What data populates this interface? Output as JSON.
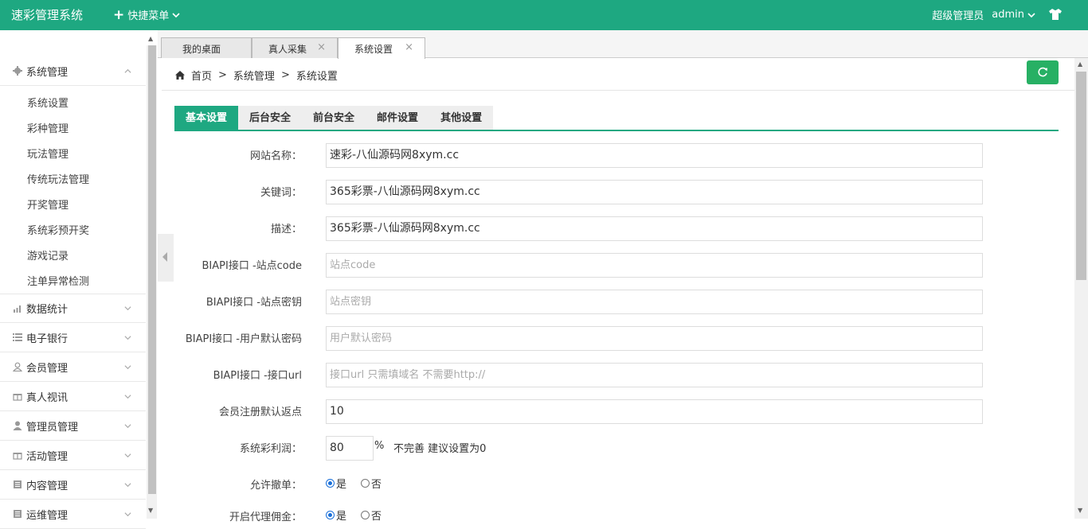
{
  "app": {
    "brand": "速彩管理系统",
    "quick_menu": "快捷菜单",
    "role": "超级管理员",
    "username": "admin",
    "accent": "#1ea881"
  },
  "sidebar": {
    "groups": [
      {
        "label": "系统管理",
        "icon": "gear-icon",
        "expanded": true,
        "items": [
          "系统设置",
          "彩种管理",
          "玩法管理",
          "传统玩法管理",
          "开奖管理",
          "系统彩预开奖",
          "游戏记录",
          "注单异常检测"
        ]
      },
      {
        "label": "数据统计",
        "icon": "chart-icon"
      },
      {
        "label": "电子银行",
        "icon": "list-icon"
      },
      {
        "label": "会员管理",
        "icon": "user-icon"
      },
      {
        "label": "真人视讯",
        "icon": "gift-icon"
      },
      {
        "label": "管理员管理",
        "icon": "person-icon"
      },
      {
        "label": "活动管理",
        "icon": "gift-icon"
      },
      {
        "label": "内容管理",
        "icon": "book-icon"
      },
      {
        "label": "运维管理",
        "icon": "book-icon"
      }
    ]
  },
  "tabs": [
    {
      "label": "我的桌面",
      "closable": false
    },
    {
      "label": "真人采集",
      "closable": true
    },
    {
      "label": "系统设置",
      "closable": true,
      "active": true
    }
  ],
  "breadcrumb": [
    "首页",
    "系统管理",
    "系统设置"
  ],
  "subtabs": [
    "基本设置",
    "后台安全",
    "前台安全",
    "邮件设置",
    "其他设置"
  ],
  "form": {
    "site_name": {
      "label": "网站名称：",
      "value": "速彩-八仙源码网8xym.cc"
    },
    "keywords": {
      "label": "关键词：",
      "value": "365彩票-八仙源码网8xym.cc"
    },
    "description": {
      "label": "描述：",
      "value": "365彩票-八仙源码网8xym.cc"
    },
    "biapi_code": {
      "label": "BIAPI接口 -站点code",
      "placeholder": "站点code"
    },
    "biapi_key": {
      "label": "BIAPI接口 -站点密钥",
      "placeholder": "站点密钥"
    },
    "biapi_pwd": {
      "label": "BIAPI接口 -用户默认密码",
      "placeholder": "用户默认密码"
    },
    "biapi_url": {
      "label": "BIAPI接口 -接口url",
      "placeholder": "接口url 只需填域名 不需要http://"
    },
    "rebate": {
      "label": "会员注册默认返点",
      "value": "10"
    },
    "profit": {
      "label": "系统彩利润：",
      "value": "80",
      "suffix": "%",
      "note": "不完善 建议设置为0"
    },
    "allow_cancel": {
      "label": "允许撤单：",
      "yes": "是",
      "no": "否",
      "selected": "是"
    },
    "agent_commission": {
      "label": "开启代理佣金：",
      "yes": "是",
      "no": "否",
      "selected": "是"
    }
  }
}
